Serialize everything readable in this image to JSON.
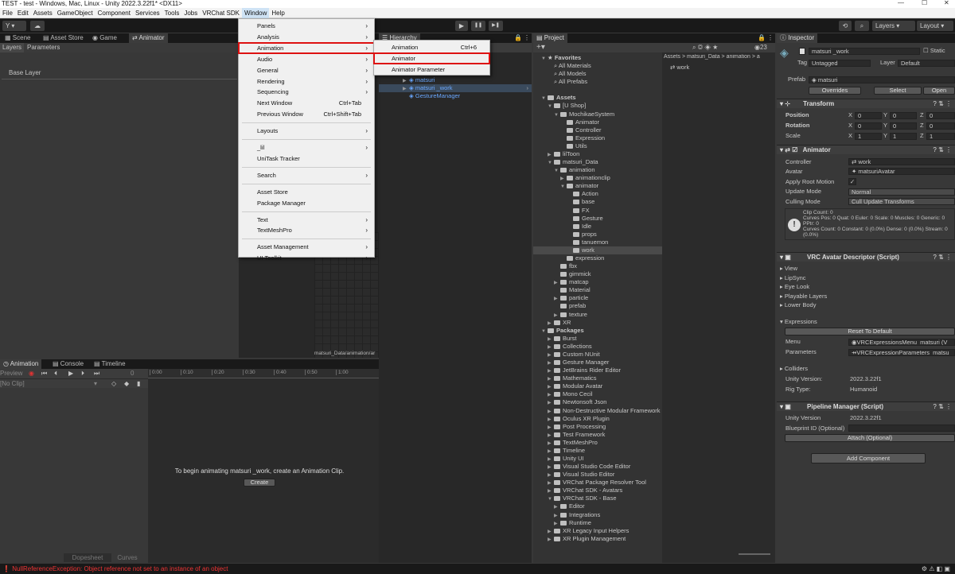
{
  "titlebar": {
    "title": "TEST - test - Windows, Mac, Linux - Unity 2022.3.22f1* <DX11>",
    "min": "—",
    "max": "☐",
    "close": "✕"
  },
  "menubar": [
    "File",
    "Edit",
    "Assets",
    "GameObject",
    "Component",
    "Services",
    "Tools",
    "Jobs",
    "VRChat SDK",
    "Window",
    "Help"
  ],
  "toolbar": {
    "account": "Y",
    "layers": "Layers",
    "layout": "Layout",
    "play": "▶",
    "pause": "❚❚",
    "step": "▶❚"
  },
  "left_tabs": {
    "scene": "Scene",
    "asset_store": "Asset Store",
    "game": "Game",
    "animator": "Animator"
  },
  "animator": {
    "layers_tab": "Layers",
    "params_tab": "Parameters",
    "base_layer": "Base Layer",
    "path": "matsuri_Data/animation/ar"
  },
  "bottom_tabs": {
    "animation": "Animation",
    "console": "Console",
    "timeline": "Timeline"
  },
  "animation_panel": {
    "preview": "Preview",
    "clip": "[No Clip]",
    "frame": "0",
    "ticks": [
      "0:00",
      "0:10",
      "0:20",
      "0:30",
      "0:40",
      "0:50",
      "1:00"
    ],
    "message": "To begin animating matsuri _work, create an Animation Clip.",
    "create": "Create",
    "dopesheet": "Dopesheet",
    "curves": "Curves"
  },
  "hierarchy": {
    "tab": "Hierarchy",
    "items": [
      "matsuri",
      "matsuri _work",
      "GestureManager"
    ]
  },
  "project": {
    "tab": "Project",
    "count": "23",
    "breadcrumb": "Assets > matsuri_Data > animation > a",
    "selected_asset": "work",
    "tree": [
      {
        "t": "Favorites",
        "d": 0,
        "k": "star",
        "arrow": "▼"
      },
      {
        "t": "All Materials",
        "d": 1,
        "k": "search"
      },
      {
        "t": "All Models",
        "d": 1,
        "k": "search"
      },
      {
        "t": "All Prefabs",
        "d": 1,
        "k": "search"
      },
      {
        "t": "",
        "d": 0,
        "k": "blank"
      },
      {
        "t": "Assets",
        "d": 0,
        "k": "folder",
        "arrow": "▼"
      },
      {
        "t": "[U Shop]",
        "d": 1,
        "k": "folder",
        "arrow": "▼"
      },
      {
        "t": "MochikaeSystem",
        "d": 2,
        "k": "folder",
        "arrow": "▼"
      },
      {
        "t": "Animator",
        "d": 3,
        "k": "folder"
      },
      {
        "t": "Controller",
        "d": 3,
        "k": "folder"
      },
      {
        "t": "Expression",
        "d": 3,
        "k": "folder"
      },
      {
        "t": "Utils",
        "d": 3,
        "k": "folder"
      },
      {
        "t": "lilToon",
        "d": 1,
        "k": "folder",
        "arrow": "▶"
      },
      {
        "t": "matsuri_Data",
        "d": 1,
        "k": "folder",
        "arrow": "▼"
      },
      {
        "t": "animation",
        "d": 2,
        "k": "folder",
        "arrow": "▼"
      },
      {
        "t": "animationclip",
        "d": 3,
        "k": "folder",
        "arrow": "▶"
      },
      {
        "t": "animator",
        "d": 3,
        "k": "folder",
        "arrow": "▼"
      },
      {
        "t": "Action",
        "d": 4,
        "k": "folder"
      },
      {
        "t": "base",
        "d": 4,
        "k": "folder"
      },
      {
        "t": "FX",
        "d": 4,
        "k": "folder"
      },
      {
        "t": "Gesture",
        "d": 4,
        "k": "folder"
      },
      {
        "t": "Idle",
        "d": 4,
        "k": "folder"
      },
      {
        "t": "props",
        "d": 4,
        "k": "folder"
      },
      {
        "t": "tanuemon",
        "d": 4,
        "k": "folder"
      },
      {
        "t": "work",
        "d": 4,
        "k": "folder",
        "sel": true
      },
      {
        "t": "expression",
        "d": 3,
        "k": "folder"
      },
      {
        "t": "fbx",
        "d": 2,
        "k": "folder"
      },
      {
        "t": "gimmick",
        "d": 2,
        "k": "folder"
      },
      {
        "t": "matcap",
        "d": 2,
        "k": "folder",
        "arrow": "▶"
      },
      {
        "t": "Material",
        "d": 2,
        "k": "folder"
      },
      {
        "t": "particle",
        "d": 2,
        "k": "folder",
        "arrow": "▶"
      },
      {
        "t": "prefab",
        "d": 2,
        "k": "folder"
      },
      {
        "t": "texture",
        "d": 2,
        "k": "folder",
        "arrow": "▶"
      },
      {
        "t": "XR",
        "d": 1,
        "k": "folder",
        "arrow": "▶"
      },
      {
        "t": "Packages",
        "d": 0,
        "k": "folder",
        "arrow": "▼"
      },
      {
        "t": "Burst",
        "d": 1,
        "k": "folder",
        "arrow": "▶"
      },
      {
        "t": "Collections",
        "d": 1,
        "k": "folder",
        "arrow": "▶"
      },
      {
        "t": "Custom NUnit",
        "d": 1,
        "k": "folder",
        "arrow": "▶"
      },
      {
        "t": "Gesture Manager",
        "d": 1,
        "k": "folder",
        "arrow": "▶"
      },
      {
        "t": "JetBrains Rider Editor",
        "d": 1,
        "k": "folder",
        "arrow": "▶"
      },
      {
        "t": "Mathematics",
        "d": 1,
        "k": "folder",
        "arrow": "▶"
      },
      {
        "t": "Modular Avatar",
        "d": 1,
        "k": "folder",
        "arrow": "▶"
      },
      {
        "t": "Mono Cecil",
        "d": 1,
        "k": "folder",
        "arrow": "▶"
      },
      {
        "t": "Newtonsoft Json",
        "d": 1,
        "k": "folder",
        "arrow": "▶"
      },
      {
        "t": "Non-Destructive Modular Framework",
        "d": 1,
        "k": "folder",
        "arrow": "▶"
      },
      {
        "t": "Oculus XR Plugin",
        "d": 1,
        "k": "folder",
        "arrow": "▶"
      },
      {
        "t": "Post Processing",
        "d": 1,
        "k": "folder",
        "arrow": "▶"
      },
      {
        "t": "Test Framework",
        "d": 1,
        "k": "folder",
        "arrow": "▶"
      },
      {
        "t": "TextMeshPro",
        "d": 1,
        "k": "folder",
        "arrow": "▶"
      },
      {
        "t": "Timeline",
        "d": 1,
        "k": "folder",
        "arrow": "▶"
      },
      {
        "t": "Unity UI",
        "d": 1,
        "k": "folder",
        "arrow": "▶"
      },
      {
        "t": "Visual Studio Code Editor",
        "d": 1,
        "k": "folder",
        "arrow": "▶"
      },
      {
        "t": "Visual Studio Editor",
        "d": 1,
        "k": "folder",
        "arrow": "▶"
      },
      {
        "t": "VRChat Package Resolver Tool",
        "d": 1,
        "k": "folder",
        "arrow": "▶"
      },
      {
        "t": "VRChat SDK - Avatars",
        "d": 1,
        "k": "folder",
        "arrow": "▶"
      },
      {
        "t": "VRChat SDK - Base",
        "d": 1,
        "k": "folder",
        "arrow": "▼"
      },
      {
        "t": "Editor",
        "d": 2,
        "k": "folder",
        "arrow": "▶"
      },
      {
        "t": "Integrations",
        "d": 2,
        "k": "folder",
        "arrow": "▶"
      },
      {
        "t": "Runtime",
        "d": 2,
        "k": "folder",
        "arrow": "▶"
      },
      {
        "t": "XR Legacy Input Helpers",
        "d": 1,
        "k": "folder",
        "arrow": "▶"
      },
      {
        "t": "XR Plugin Management",
        "d": 1,
        "k": "folder",
        "arrow": "▶"
      }
    ]
  },
  "inspector": {
    "tab": "Inspector",
    "name": "matsuri _work",
    "static": "Static",
    "tag_label": "Tag",
    "tag": "Untagged",
    "layer_label": "Layer",
    "layer": "Default",
    "prefab_label": "Prefab",
    "prefab": "matsuri",
    "overrides": "Overrides",
    "select": "Select",
    "open": "Open",
    "transform": {
      "title": "Transform",
      "rows": [
        {
          "l": "Position",
          "x": "0",
          "y": "0",
          "z": "0"
        },
        {
          "l": "Rotation",
          "x": "0",
          "y": "0",
          "z": "0"
        },
        {
          "l": "Scale",
          "x": "1",
          "y": "1",
          "z": "1"
        }
      ]
    },
    "animator": {
      "title": "Animator",
      "controller_label": "Controller",
      "controller": "work",
      "avatar_label": "Avatar",
      "avatar": "matsuriAvatar",
      "root_motion_label": "Apply Root Motion",
      "update_label": "Update Mode",
      "update": "Normal",
      "culling_label": "Culling Mode",
      "culling": "Cull Update Transforms",
      "info": [
        "Clip Count: 0",
        "Curves Pos: 0 Quat: 0 Euler: 0 Scale: 0 Muscles: 0 Generic: 0 PPtr: 0",
        "Curves Count: 0 Constant: 0 (0.0%) Dense: 0 (0.0%) Stream: 0 (0.0%)"
      ]
    },
    "vrc": {
      "title": "VRC Avatar Descriptor (Script)",
      "foldouts": [
        "View",
        "LipSync",
        "Eye Look",
        "Playable Layers",
        "Lower Body"
      ],
      "expressions": "Expressions",
      "reset": "Reset To Default",
      "menu_label": "Menu",
      "menu": "VRCExpressionsMenu_matsuri (V",
      "params_label": "Parameters",
      "params": "VRCExpressionParameters_matsu",
      "colliders": "Colliders",
      "unity_version_label": "Unity Version:",
      "unity_version": "2022.3.22f1",
      "rig_label": "Rig Type:",
      "rig": "Humanoid"
    },
    "pipeline": {
      "title": "Pipeline Manager (Script)",
      "unity_label": "Unity Version",
      "unity": "2022.3.22f1",
      "bp_label": "Blueprint ID (Optional)",
      "attach": "Attach (Optional)"
    },
    "add_component": "Add Component"
  },
  "window_menu": [
    {
      "t": "Panels",
      "a": true
    },
    {
      "t": "Analysis",
      "a": true
    },
    {
      "t": "Animation",
      "a": true,
      "hl": true
    },
    {
      "t": "Audio",
      "a": true
    },
    {
      "t": "General",
      "a": true
    },
    {
      "t": "Rendering",
      "a": true
    },
    {
      "t": "Sequencing",
      "a": true
    },
    {
      "t": "Next Window",
      "s": "Ctrl+Tab"
    },
    {
      "t": "Previous Window",
      "s": "Ctrl+Shift+Tab"
    },
    {
      "sep": true
    },
    {
      "t": "Layouts",
      "a": true
    },
    {
      "sep": true
    },
    {
      "t": "_lil",
      "a": true
    },
    {
      "t": "UniTask Tracker"
    },
    {
      "sep": true
    },
    {
      "t": "Search",
      "a": true
    },
    {
      "sep": true
    },
    {
      "t": "Asset Store"
    },
    {
      "t": "Package Manager"
    },
    {
      "sep": true
    },
    {
      "t": "Text",
      "a": true
    },
    {
      "t": "TextMeshPro",
      "a": true
    },
    {
      "sep": true
    },
    {
      "t": "Asset Management",
      "a": true
    },
    {
      "t": "UI Toolkit",
      "a": true
    }
  ],
  "anim_submenu": [
    {
      "t": "Animation",
      "s": "Ctrl+6"
    },
    {
      "t": "Animator",
      "hl": true
    },
    {
      "t": "Animator Parameter"
    }
  ],
  "status": "NullReferenceException: Object reference not set to an instance of an object"
}
